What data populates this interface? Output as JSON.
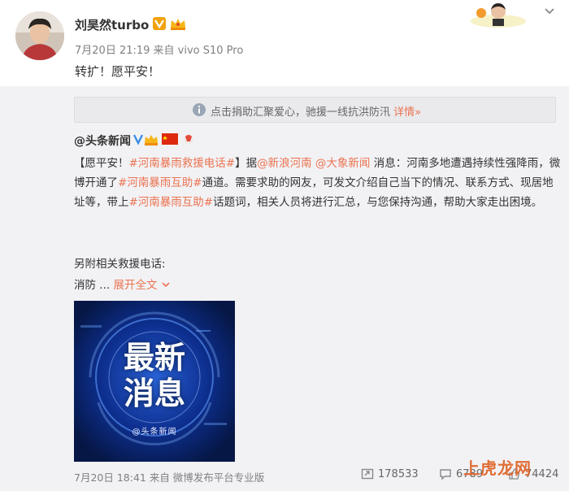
{
  "post": {
    "username": "刘昊然turbo",
    "meta": "7月20日 21:19 来自 vivo S10 Pro",
    "content": "转扩！愿平安！"
  },
  "notice": {
    "text": "点击捐助汇聚爱心，驰援一线抗洪防汛",
    "link": "详情»"
  },
  "repost": {
    "user": "@头条新闻",
    "body": {
      "p1": "【愿平安！",
      "t1": "#河南暴雨救援电话#",
      "p2": "】据",
      "u1": "@新浪河南",
      "p3": " ",
      "u2": "@大象新闻",
      "p4": " 消息：河南多地遭遇持续性强降雨，微博开通了",
      "t2": "#河南暴雨互助#",
      "p5": "通道。需要求助的网友，可发文介绍自己当下的情况、联系方式、现居地址等，带上",
      "t3": "#河南暴雨互助#",
      "p6": "话题词，相关人员将进行汇总，与您保持沟通，帮助大家走出困境。"
    },
    "extra_line": "另附相关救援电话:",
    "extra_prefix": "消防 ...",
    "expand": "展开全文",
    "image_title_1": "最新",
    "image_title_2": "消息",
    "image_caption": "@头条新闻",
    "footer_meta": "7月20日 18:41 来自 微博发布平台专业版",
    "stats": {
      "reposts": "178533",
      "comments": "6789",
      "likes": "74424"
    }
  },
  "watermark": "上虎龙网",
  "colors": {
    "accent": "#eb7350",
    "bg_repost": "#f2f2f5",
    "image_bg": "#071b5a"
  }
}
